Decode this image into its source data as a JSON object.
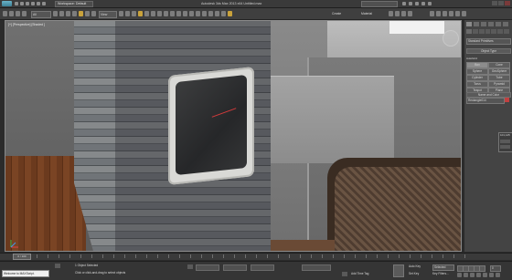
{
  "titlebar": {
    "workspace": "Workspace: Default",
    "title": "Autodesk 3ds Max 2013 x64    Untitled.max",
    "search_placeholder": "Type a keyword or phrase"
  },
  "toolbar": {
    "view_select": "View",
    "ribbon_create": "Create",
    "ribbon_material": "Material"
  },
  "viewport": {
    "label": "[+] [Perspective] [Shaded ]"
  },
  "command_panel": {
    "dropdown": "Standard Primitives",
    "object_type": "Object Type",
    "autogrid": "AutoGrid",
    "buttons": [
      "Box",
      "Cone",
      "Sphere",
      "GeoSphere",
      "Cylinder",
      "Tube",
      "Torus",
      "Pyramid",
      "Teapot",
      "Plane"
    ],
    "name_and_color": "Name and Color",
    "name_value": "Rectangle014",
    "float_dialog": "101,125"
  },
  "timeline": {
    "slider": "0 / 100"
  },
  "status": {
    "listener": "Welcome to MAXScript.",
    "msg1": "1 Object Selected",
    "msg2": "Click or click-and-drag to select objects",
    "add_time_tag": "Add Time Tag",
    "autokey": "Auto Key",
    "selected": "Selected",
    "setkey": "Set Key",
    "key_filters": "Key Filters...",
    "frame": "0"
  },
  "colors": {
    "accent": "#c9a23b",
    "selection_red": "#c04040"
  }
}
